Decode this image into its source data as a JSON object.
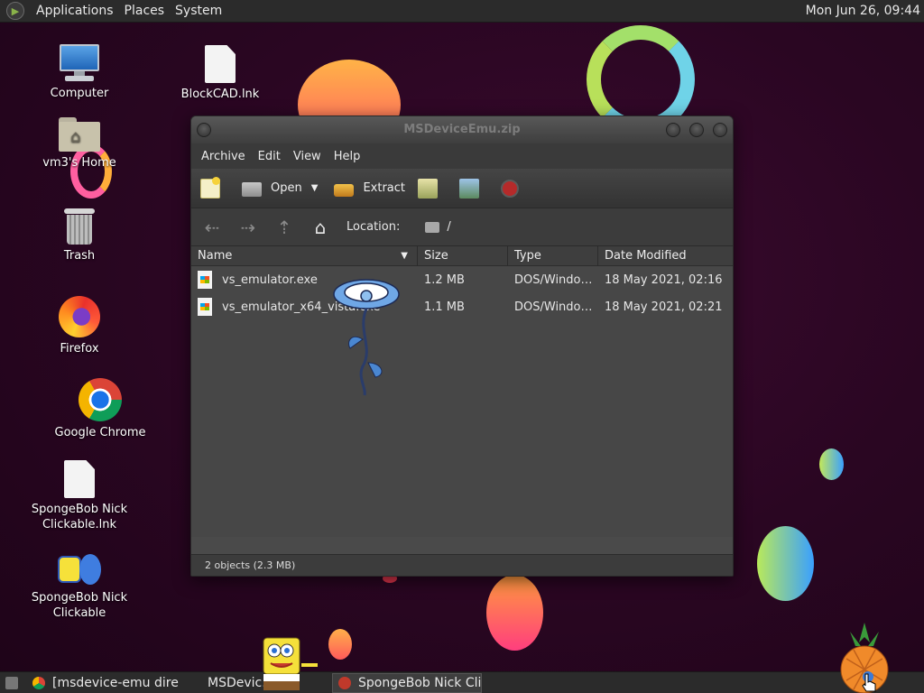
{
  "top_panel": {
    "menus": [
      "Applications",
      "Places",
      "System"
    ],
    "clock": "Mon Jun 26, 09:44"
  },
  "desktop_icons": [
    {
      "label": "Computer",
      "icon": "computer-icon"
    },
    {
      "label": "BlockCAD.lnk",
      "icon": "document-icon"
    },
    {
      "label": "vm3's Home",
      "icon": "home-folder-icon"
    },
    {
      "label": "Trash",
      "icon": "trash-icon"
    },
    {
      "label": "Firefox",
      "icon": "firefox-icon"
    },
    {
      "label": "Google Chrome",
      "icon": "chrome-icon"
    },
    {
      "label": "SpongeBob Nick Clickable.lnk",
      "icon": "document-icon"
    },
    {
      "label": "SpongeBob Nick Clickable",
      "icon": "spongebob-icon"
    }
  ],
  "window": {
    "title": "MSDeviceEmu.zip",
    "menu": [
      "Archive",
      "Edit",
      "View",
      "Help"
    ],
    "toolbar": {
      "open_label": "Open",
      "extract_label": "Extract"
    },
    "location": {
      "label": "Location:",
      "path": "/"
    },
    "columns": [
      "Name",
      "Size",
      "Type",
      "Date Modified"
    ],
    "rows": [
      {
        "name": "vs_emulator.exe",
        "size": "1.2 MB",
        "type": "DOS/Windo…",
        "date": "18 May 2021, 02:16"
      },
      {
        "name": "vs_emulator_x64_vista.exe",
        "size": "1.1 MB",
        "type": "DOS/Windo…",
        "date": "18 May 2021, 02:21"
      }
    ],
    "status": "2 objects (2.3 MB)"
  },
  "taskbar": {
    "items": [
      {
        "label": "[msdevice-emu dire…",
        "icon": "chrome-icon"
      },
      {
        "label": "MSDevic…",
        "icon": "archive-icon"
      },
      {
        "label": "SpongeBob Nick Cli…",
        "icon": "app-icon"
      }
    ]
  }
}
